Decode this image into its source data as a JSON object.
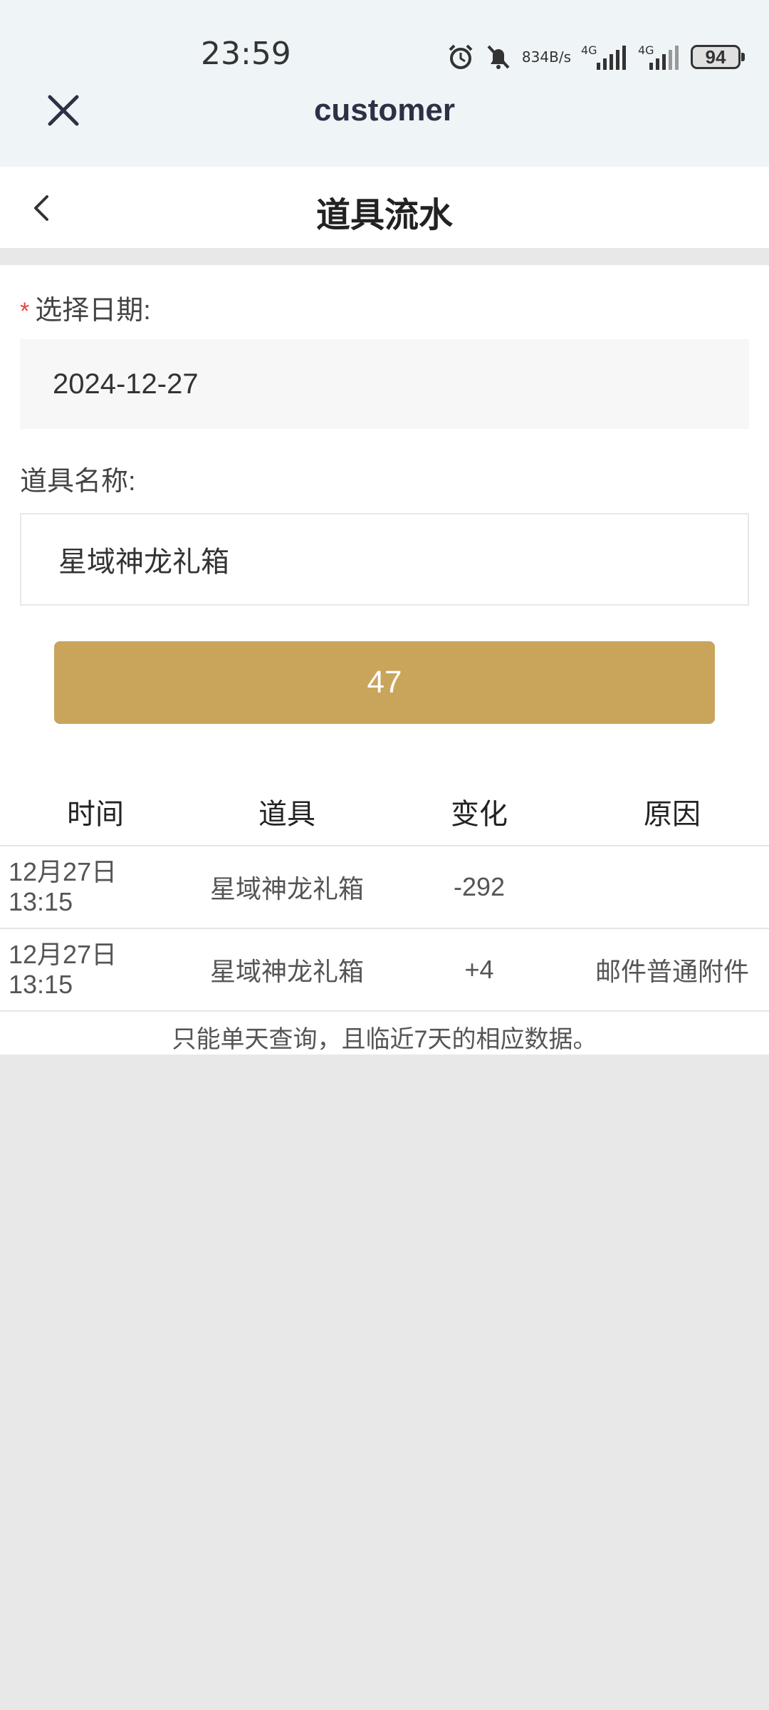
{
  "status_bar": {
    "time": "23:59",
    "net_speed_value": "834",
    "net_speed_unit": "B/s",
    "signal1_label": "4G",
    "signal2_label": "4G",
    "battery": "94",
    "icons": [
      "alarm-icon",
      "mute-bell-icon",
      "signal-icon",
      "battery-icon"
    ]
  },
  "app_header": {
    "title": "customer",
    "close_icon": "close-icon"
  },
  "nav": {
    "title": "道具流水",
    "back_icon": "chevron-left-icon"
  },
  "form": {
    "required_mark": "*",
    "date_label": "选择日期:",
    "date_value": "2024-12-27",
    "name_label": "道具名称:",
    "name_value": "星域神龙礼箱",
    "button_label": "47"
  },
  "table": {
    "headers": [
      "时间",
      "道具",
      "变化",
      "原因"
    ],
    "rows": [
      {
        "time": "12月27日\n13:15",
        "item": "星域神龙礼箱",
        "change": "-292",
        "reason": ""
      },
      {
        "time": "12月27日\n13:15",
        "item": "星域神龙礼箱",
        "change": "+4",
        "reason": "邮件普通附件"
      }
    ],
    "note": "只能单天查询，且临近7天的相应数据。"
  },
  "colors": {
    "accent": "#c9a55c",
    "header_bg": "#eff4f7",
    "title_color": "#2c3145",
    "required": "#e04848"
  }
}
